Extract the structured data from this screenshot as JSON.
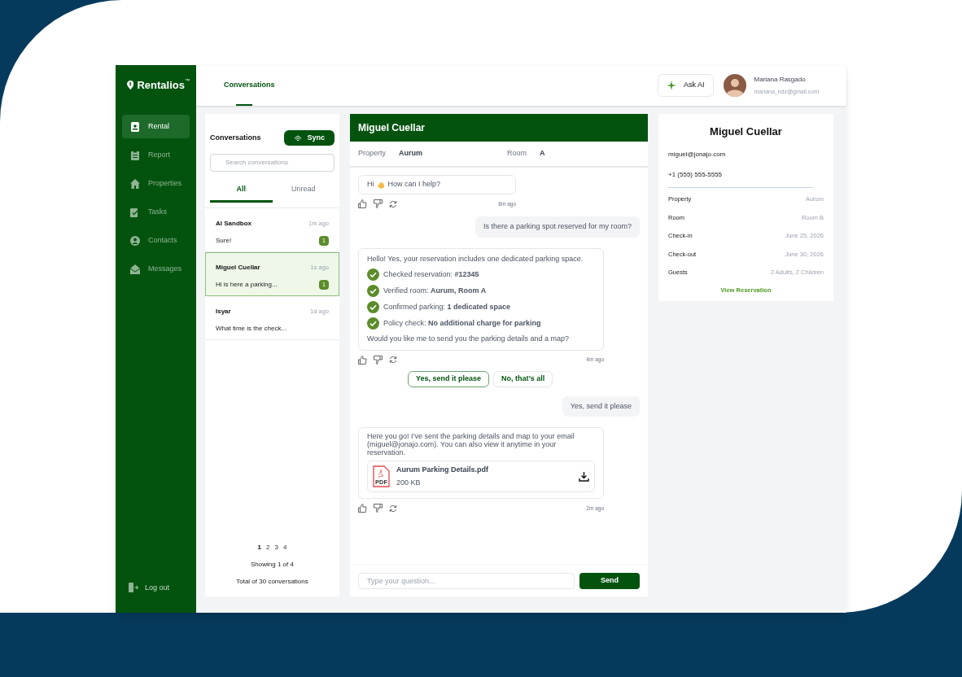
{
  "brand": {
    "name": "Rentalios",
    "mark": "™"
  },
  "nav": [
    {
      "label": "Rental",
      "selected": true
    },
    {
      "label": "Report",
      "selected": false
    },
    {
      "label": "Properties",
      "selected": false
    },
    {
      "label": "Tasks",
      "selected": false
    },
    {
      "label": "Contacts",
      "selected": false
    },
    {
      "label": "Messages",
      "selected": false
    }
  ],
  "logout": "Log out",
  "header": {
    "tabs": [
      {
        "label": "Conversations",
        "selected": true
      }
    ],
    "ask_ai": "Ask AI",
    "user": {
      "name": "Mariana Rasgado",
      "email": "mariana_hdz@gmail.com"
    }
  },
  "conversations": {
    "title": "Conversations",
    "sync": "Sync",
    "search_placeholder": "Search conversations",
    "filters": [
      {
        "label": "All",
        "selected": true
      },
      {
        "label": "Unread",
        "selected": false
      }
    ],
    "items": [
      {
        "name": "AI Sandbox",
        "time": "1m ago",
        "preview": "Sure!",
        "unread": "1",
        "selected": false
      },
      {
        "name": "Miguel Cuellar",
        "time": "1s ago",
        "preview": "Hi is here a parking...",
        "unread": "1",
        "selected": true
      },
      {
        "name": "Isyar",
        "time": "1d ago",
        "preview": "What time is the check...",
        "selected": false
      }
    ],
    "pages": [
      {
        "label": "1",
        "selected": true
      },
      {
        "label": "2",
        "selected": false
      },
      {
        "label": "3",
        "selected": false
      },
      {
        "label": "4",
        "selected": false
      }
    ],
    "showing": "Showing 1 of 4",
    "total": "Total of 30 conversations"
  },
  "chat": {
    "name": "Miguel Cuellar",
    "meta": [
      {
        "label": "Property",
        "value": "Aurum"
      },
      {
        "label": "Room",
        "value": "A"
      }
    ],
    "messages": [
      {
        "kind": "bot_greeting",
        "before": "Hi",
        "after": "How can I help?",
        "time": "8m ago"
      },
      {
        "kind": "user",
        "text": "Is there a parking spot reserved for my room?"
      },
      {
        "kind": "bot_checklist",
        "intro": "Hello! Yes, your reservation includes one dedicated parking space.",
        "checks": [
          "Checked reservation: **#12345**",
          "Verified room: **Aurum, Room A**",
          "Confirmed parking: **1 dedicated space**",
          "Policy check: **No additional charge for parking**"
        ],
        "outro": "Would you like me to send you the parking details and a map?",
        "time": "4m ago"
      },
      {
        "kind": "quick_replies",
        "options": [
          {
            "label": "Yes, send it please",
            "selected": true
          },
          {
            "label": "No, that’s all",
            "selected": false
          }
        ]
      },
      {
        "kind": "user",
        "text": "Yes, send it please"
      },
      {
        "kind": "bot_file",
        "text": "Here you go! I’ve sent the parking details and map to your email (miguel@jonajo.com). You can also view it anytime in your reservation.",
        "file": {
          "name": "Aurum Parking Details.pdf",
          "size": "200 KB",
          "type": "PDF"
        },
        "time": "2m ago"
      }
    ],
    "input_placeholder": "Type your question...",
    "send": "Send"
  },
  "guest": {
    "name": "Miguel Cuellar",
    "email": "miguel@jonajo.com",
    "phone": "+1 (555) 555-5555",
    "details": [
      {
        "label": "Property",
        "value": "Aurum"
      },
      {
        "label": "Room",
        "value": "Room B"
      },
      {
        "label": "Check-in",
        "value": "June 25, 2026"
      },
      {
        "label": "Check-out",
        "value": "June 30, 2026"
      },
      {
        "label": "Guests",
        "value": "2 Adults, 2 Children"
      }
    ],
    "link": "View Reservation"
  }
}
